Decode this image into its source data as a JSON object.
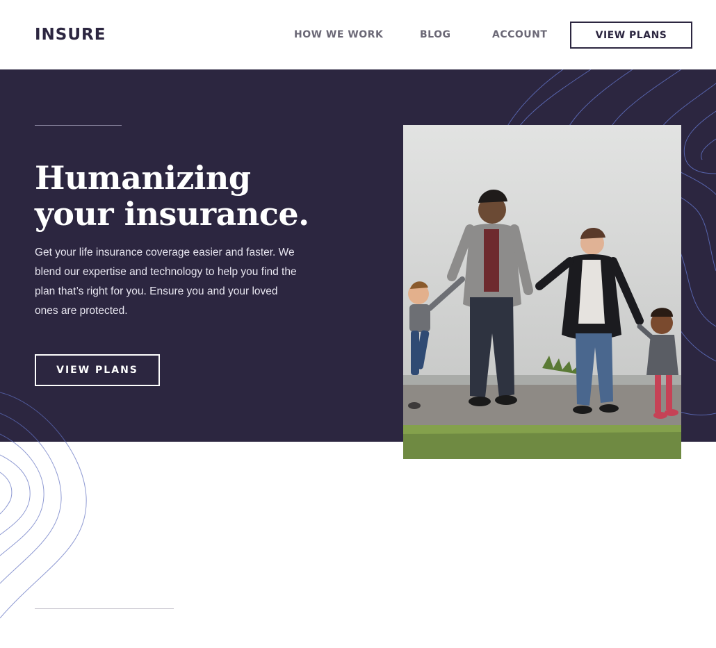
{
  "header": {
    "logo": "INSURE",
    "nav": [
      "HOW WE WORK",
      "BLOG",
      "ACCOUNT"
    ],
    "cta": "VIEW PLANS"
  },
  "hero": {
    "title_line1": "Humanizing",
    "title_line2": "your insurance.",
    "text": "Get your life insurance coverage easier and faster. We blend our expertise and technology to help you find the plan that’s right for you. Ensure you and your loved ones are protected.",
    "cta": "VIEW PLANS"
  },
  "colors": {
    "brand_dark": "#2c2640",
    "nav_text": "#6b6876",
    "contour": "#5f6fc0",
    "white": "#ffffff"
  }
}
